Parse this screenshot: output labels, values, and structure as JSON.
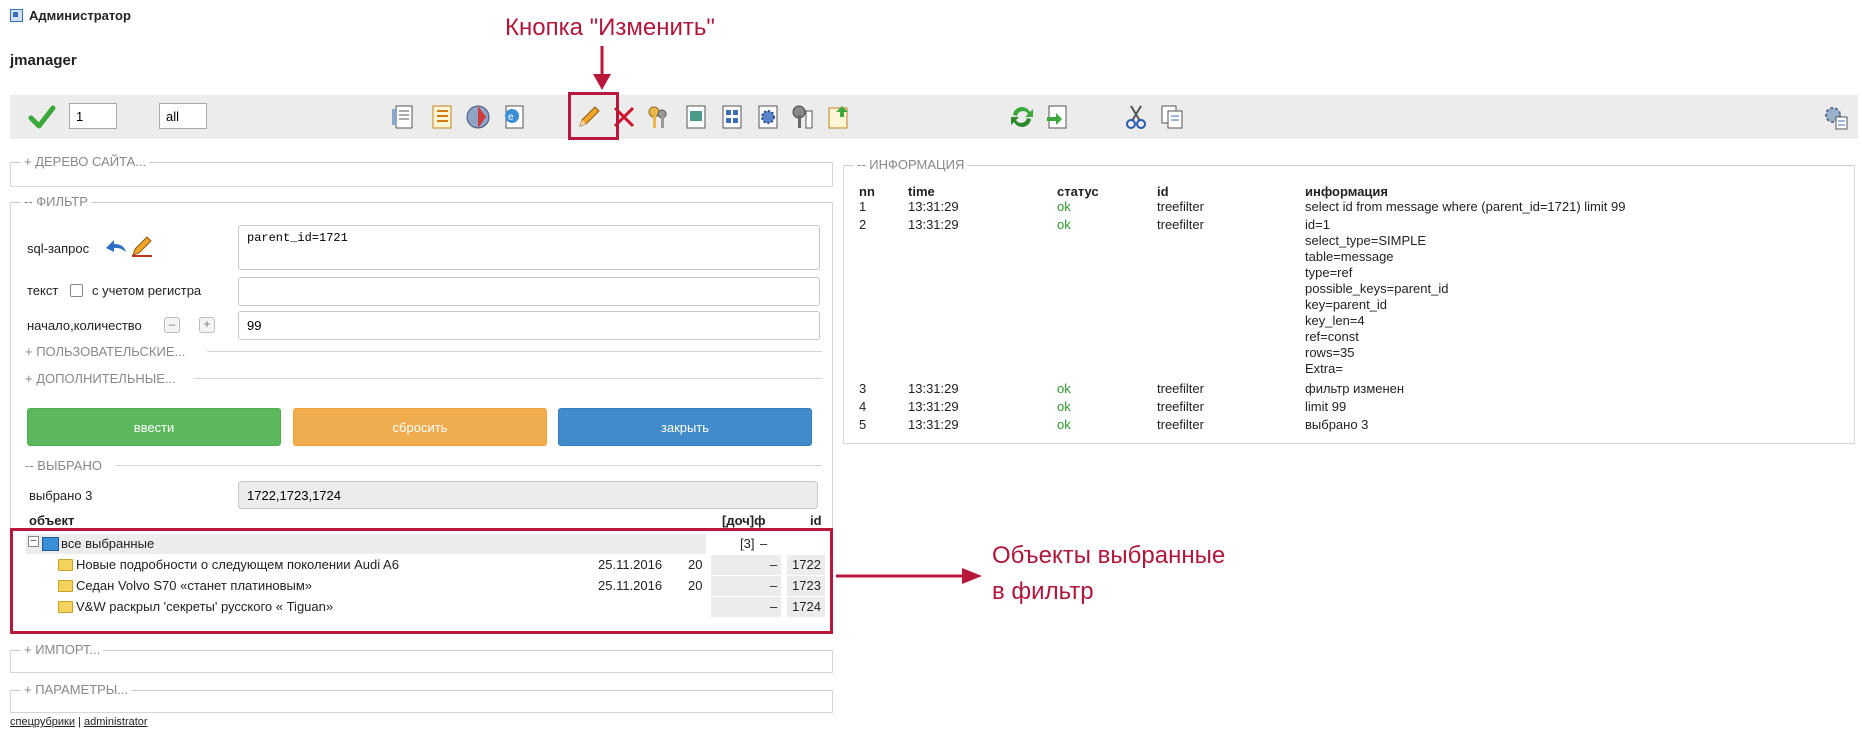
{
  "header": {
    "user": "Администратор",
    "app_title": "jmanager"
  },
  "toolbar": {
    "count_value": "1",
    "mode_value": "all",
    "icons": [
      "check-icon",
      "page-icon",
      "list-icon",
      "globe-icon",
      "web-icon",
      "pencil-icon",
      "delete-icon",
      "keys-icon",
      "image-icon",
      "grid-icon",
      "gear-icon",
      "tools-icon",
      "upload-icon",
      "refresh-icon",
      "import-icon",
      "cut-icon",
      "copy-icon",
      "settings-icon"
    ]
  },
  "annotations": {
    "edit_button": "Кнопка \"Изменить\"",
    "selected_line1": "Объекты выбранные",
    "selected_line2": "в фильтр"
  },
  "sections": {
    "site_tree": "+ ДЕРЕВО САЙТА...",
    "filter": "-- ФИЛЬТР",
    "import": "+ ИМПОРТ...",
    "params": "+ ПАРАМЕТРЫ...",
    "info": "-- ИНФОРМАЦИЯ"
  },
  "filter": {
    "sql_label": "sql-запрос",
    "sql_value": "parent_id=1721",
    "text_label": "текст",
    "case_label": "с учетом регистра",
    "text_value": "",
    "range_label": "начало,количество",
    "range_value": "99",
    "user_section": "+ ПОЛЬЗОВАТЕЛЬСКИЕ...",
    "extra_section": "+ ДОПОЛНИТЕЛЬНЫЕ...",
    "btn_apply": "ввести",
    "btn_reset": "сбросить",
    "btn_close": "закрыть",
    "selected_section": "-- ВЫБРАНО",
    "selected_label": "выбрано 3",
    "selected_value": "1722,1723,1724"
  },
  "tree": {
    "col_object": "объект",
    "col_docs": "[доч]ф",
    "col_id": "id",
    "root_label": "все выбранные",
    "root_count": "[3]",
    "root_flag": "–",
    "rows": [
      {
        "title": "Новые подробности о следующем поколении Audi A6",
        "date": "25.11.2016",
        "num": "20",
        "flag": "–",
        "id": "1722"
      },
      {
        "title": "Седан Volvo S70 «станет платиновым»",
        "date": "25.11.2016",
        "num": "20",
        "flag": "–",
        "id": "1723"
      },
      {
        "title": "V&W раскрыл 'секреты' русского « Tiguan»",
        "date": "",
        "num": "",
        "flag": "–",
        "id": "1724"
      }
    ]
  },
  "info": {
    "headers": [
      "nn",
      "time",
      "статус",
      "id",
      "информация"
    ],
    "rows": [
      {
        "nn": "1",
        "time": "13:31:29",
        "status": "ok",
        "id": "treefilter",
        "info": [
          "select id from message where (parent_id=1721) limit 99"
        ]
      },
      {
        "nn": "2",
        "time": "13:31:29",
        "status": "ok",
        "id": "treefilter",
        "info": [
          "id=1",
          "select_type=SIMPLE",
          "table=message",
          "type=ref",
          "possible_keys=parent_id",
          "key=parent_id",
          "key_len=4",
          "ref=const",
          "rows=35",
          "Extra="
        ]
      },
      {
        "nn": "3",
        "time": "13:31:29",
        "status": "ok",
        "id": "treefilter",
        "info": [
          "фильтр изменен"
        ]
      },
      {
        "nn": "4",
        "time": "13:31:29",
        "status": "ok",
        "id": "treefilter",
        "info": [
          "limit 99"
        ]
      },
      {
        "nn": "5",
        "time": "13:31:29",
        "status": "ok",
        "id": "treefilter",
        "info": [
          "выбрано 3"
        ]
      }
    ]
  },
  "footer": {
    "link1": "спецрубрики",
    "separator": "|",
    "link2": "administrator"
  },
  "colors": {
    "accent_red": "#b8183b",
    "ok_green": "#2e9a2e",
    "btn_green": "#5cb85c",
    "btn_orange": "#f0ad4e",
    "btn_blue": "#428bca"
  }
}
